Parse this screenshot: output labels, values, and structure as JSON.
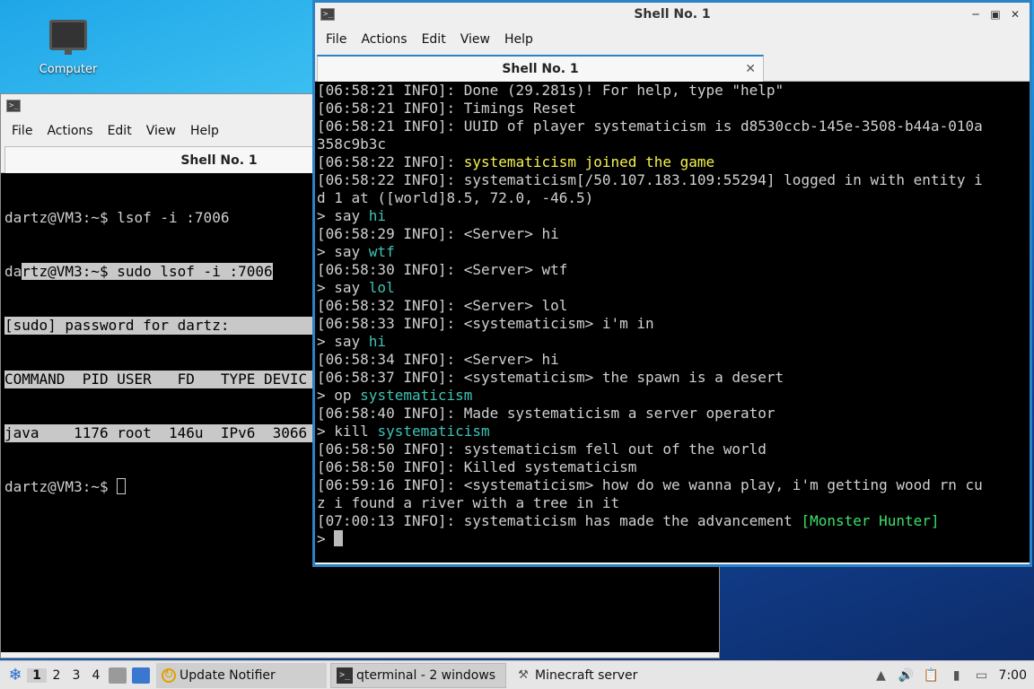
{
  "desktop": {
    "icon_label": "Computer"
  },
  "back_window": {
    "menu": [
      "File",
      "Actions",
      "Edit",
      "View",
      "Help"
    ],
    "tab_title": "Shell No. 1",
    "lines": [
      "dartz@VM3:~$ lsof -i :7006",
      "dartz@VM3:~$ sudo lsof -i :7006",
      "[sudo] password for dartz:",
      "COMMAND  PID USER   FD   TYPE DEVIC",
      "java    1176 root  146u  IPv6  3066",
      "dartz@VM3:~$ "
    ]
  },
  "front_window": {
    "title": "Shell No. 1",
    "menu": [
      "File",
      "Actions",
      "Edit",
      "View",
      "Help"
    ],
    "tab_title": "Shell No. 1",
    "lines": [
      [
        {
          "t": "[06:58:21 INFO]: Done (29.281s)! For help, type \"help\""
        }
      ],
      [
        {
          "t": "[06:58:21 INFO]: Timings Reset"
        }
      ],
      [
        {
          "t": "[06:58:21 INFO]: UUID of player systematicism is d8530ccb-145e-3508-b44a-010a"
        }
      ],
      [
        {
          "t": "358c9b3c"
        }
      ],
      [
        {
          "t": "[06:58:22 INFO]: "
        },
        {
          "t": "systematicism joined the game",
          "c": "yel"
        }
      ],
      [
        {
          "t": "[06:58:22 INFO]: systematicism[/50.107.183.109:55294] logged in with entity i"
        }
      ],
      [
        {
          "t": "d 1 at ([world]8.5, 72.0, -46.5)"
        }
      ],
      [
        {
          "t": "> say "
        },
        {
          "t": "hi",
          "c": "teal"
        }
      ],
      [
        {
          "t": "[06:58:29 INFO]: <Server> hi"
        }
      ],
      [
        {
          "t": "> say "
        },
        {
          "t": "wtf",
          "c": "teal"
        }
      ],
      [
        {
          "t": "[06:58:30 INFO]: <Server> wtf"
        }
      ],
      [
        {
          "t": "> say "
        },
        {
          "t": "lol",
          "c": "teal"
        }
      ],
      [
        {
          "t": "[06:58:32 INFO]: <Server> lol"
        }
      ],
      [
        {
          "t": "[06:58:33 INFO]: <systematicism> i'm in"
        }
      ],
      [
        {
          "t": "> say "
        },
        {
          "t": "hi",
          "c": "teal"
        }
      ],
      [
        {
          "t": "[06:58:34 INFO]: <Server> hi"
        }
      ],
      [
        {
          "t": "[06:58:37 INFO]: <systematicism> the spawn is a desert"
        }
      ],
      [
        {
          "t": "> op "
        },
        {
          "t": "systematicism",
          "c": "teal"
        }
      ],
      [
        {
          "t": "[06:58:40 INFO]: Made systematicism a server operator"
        }
      ],
      [
        {
          "t": "> kill "
        },
        {
          "t": "systematicism",
          "c": "teal"
        }
      ],
      [
        {
          "t": "[06:58:50 INFO]: systematicism fell out of the world"
        }
      ],
      [
        {
          "t": "[06:58:50 INFO]: Killed systematicism"
        }
      ],
      [
        {
          "t": "[06:59:16 INFO]: <systematicism> how do we wanna play, i'm getting wood rn cu"
        }
      ],
      [
        {
          "t": "z i found a river with a tree in it"
        }
      ],
      [
        {
          "t": "[07:00:13 INFO]: systematicism has made the advancement "
        },
        {
          "t": "[Monster Hunter]",
          "c": "grn"
        }
      ],
      [
        {
          "t": "> "
        }
      ]
    ]
  },
  "taskbar": {
    "workspaces": [
      "1",
      "2",
      "3",
      "4"
    ],
    "tasks": [
      {
        "label": "Update Notifier",
        "icon": "update-notifier-icon"
      },
      {
        "label": "qterminal - 2 windows",
        "icon": "terminal-icon"
      },
      {
        "label": "Minecraft server",
        "icon": "minecraft-server-icon"
      }
    ],
    "clock": "7:00"
  },
  "colors": {
    "accent": "#2a83c6",
    "highlight_yellow": "#f6f34d",
    "highlight_teal": "#3ec3b6",
    "highlight_green": "#3ae06a"
  }
}
